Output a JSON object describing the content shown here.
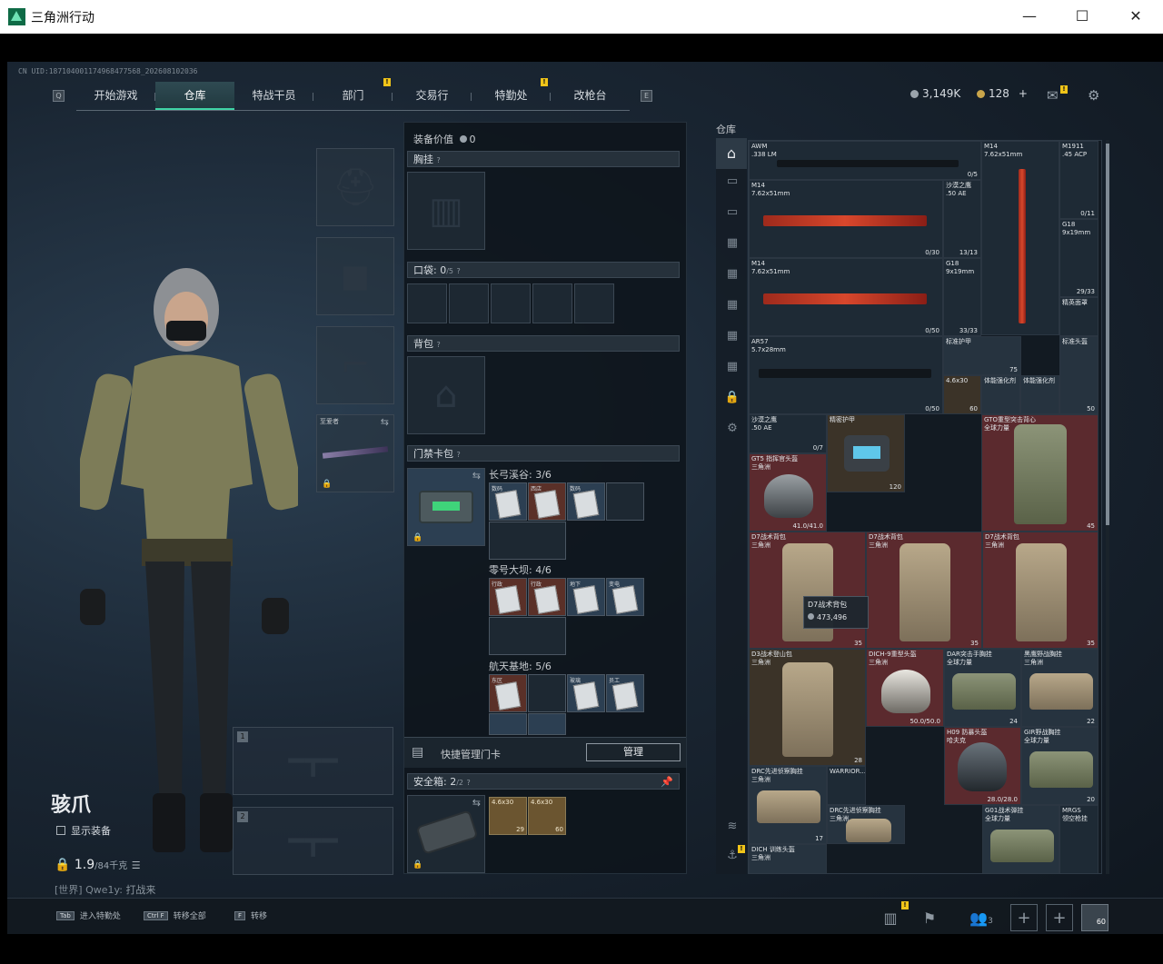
{
  "window": {
    "title": "三角洲行动",
    "min": "—",
    "max": "☐",
    "close": "✕"
  },
  "uid": "CN UID:1871040011749684775​68_202608102036",
  "nav": {
    "key_left": "Q",
    "key_right": "E",
    "tabs": [
      "开始游戏",
      "仓库",
      "特战干员",
      "部门",
      "交易行",
      "特勤处",
      "改枪台"
    ],
    "active": 1,
    "badges": [
      "!",
      "!"
    ]
  },
  "currency": {
    "silver": "3,149K",
    "gold": "128",
    "add": "+"
  },
  "mail_badge": "!",
  "character": {
    "name": "骇爪",
    "show_equipment": "显示装备",
    "weight": "1.9",
    "weight_max": "/84千克",
    "status_tag": "[世界]",
    "status_name": "Qwe1y:",
    "status_text": "打战来",
    "slot_label": "至爱者",
    "slot_nums": [
      "1",
      "2"
    ]
  },
  "center": {
    "equip_value_label": "装备价值",
    "equip_value": "0",
    "chest": "胸挂",
    "pockets": "口袋:",
    "pockets_val": "0",
    "pockets_max": "/5",
    "backpack": "背包",
    "keycard": "门禁卡包",
    "help": "?",
    "card_groups": [
      {
        "label": "长弓溪谷: 3/6",
        "cards": [
          [
            "数码",
            "b"
          ],
          [
            "西店",
            "r"
          ],
          [
            "数码",
            "b"
          ],
          [
            "",
            "e"
          ]
        ]
      },
      {
        "label": "零号大坝: 4/6",
        "cards": [
          [
            "行政",
            "r"
          ],
          [
            "行政",
            "r"
          ],
          [
            "地下",
            "b"
          ],
          [
            "变电",
            "b"
          ]
        ]
      },
      {
        "label": "航天基地: 5/6",
        "cards": [
          [
            "东区",
            "r"
          ],
          [
            "",
            "e"
          ],
          [
            "玻璃",
            "b"
          ],
          [
            "员工",
            "b"
          ]
        ]
      }
    ],
    "quick_manage": "快捷管理门卡",
    "manage_btn": "管理",
    "safebox": "安全箱:",
    "safebox_val": "2",
    "safebox_max": "/2",
    "ammo": [
      {
        "t": "4.6x30",
        "c": "29"
      },
      {
        "t": "4.6x30",
        "c": "60"
      }
    ]
  },
  "warehouse": {
    "title": "仓库",
    "tooltip_name": "D7战术背包",
    "tooltip_val": "473,496",
    "items": [
      {
        "n": "AWM\n.338 LM",
        "c": "0/5"
      },
      {
        "n": "M14\n7.62x51mm",
        "c": ""
      },
      {
        "n": "M1911\n.45 ACP",
        "c": "0/11"
      },
      {
        "n": "M14\n7.62x51mm",
        "c": "0/30"
      },
      {
        "n": "沙漠之鹰\n.50 AE",
        "c": "13/13"
      },
      {
        "n": "G18\n9x19mm",
        "c": "29/33"
      },
      {
        "n": "M14\n7.62x51mm",
        "c": "0/50"
      },
      {
        "n": "G18\n9x19mm",
        "c": "33/33"
      },
      {
        "n": "",
        "c": "0/50"
      },
      {
        "n": "精英面罩",
        "c": ""
      },
      {
        "n": "AR57\n5.7x28mm",
        "c": "0/50"
      },
      {
        "n": "标准护甲",
        "c": "75"
      },
      {
        "n": "标准头盔",
        "c": "50"
      },
      {
        "n": "4.6x30",
        "c": "60"
      },
      {
        "n": "体能强化剂",
        "c": ""
      },
      {
        "n": "体能强化剂",
        "c": ""
      },
      {
        "n": "沙漠之鹰\n.50 AE",
        "c": "0/7"
      },
      {
        "n": "精密护甲",
        "c": "120"
      },
      {
        "n": "GTO重型突击背心\n全球力量",
        "c": "45"
      },
      {
        "n": "GT5 指挥官头盔\n三角洲",
        "c": "41.0/41.0"
      },
      {
        "n": "D7战术背包\n三角洲",
        "c": "35"
      },
      {
        "n": "D7战术背包\n三角洲",
        "c": "35"
      },
      {
        "n": "D7战术背包\n三角洲",
        "c": "35"
      },
      {
        "n": "D3战术登山包\n三角洲",
        "c": "28"
      },
      {
        "n": "DICH-9重型头盔\n三角洲",
        "c": "50.0/50.0"
      },
      {
        "n": "DAR突击手胸挂\n全球力量",
        "c": "24"
      },
      {
        "n": "黑鹰野战胸挂\n三角洲",
        "c": "22"
      },
      {
        "n": "H09 防暴头盔\n哈夫克",
        "c": "28.0/28.0"
      },
      {
        "n": "GIR野战胸挂\n全球力量",
        "c": "20"
      },
      {
        "n": "DRC先进侦察胸挂\n三角洲",
        "c": "17"
      },
      {
        "n": "WARRIOR...",
        "c": ""
      },
      {
        "n": "DRC先进侦察胸挂\n三角洲",
        "c": ""
      },
      {
        "n": "G01战术弹挂\n全球力量",
        "c": ""
      },
      {
        "n": "MRGS\n领空枪挂",
        "c": ""
      },
      {
        "n": "DICH 训练头盔\n三角洲",
        "c": ""
      }
    ]
  },
  "bottom": {
    "hints": [
      {
        "k": "Tab",
        "t": "进入特勤处"
      },
      {
        "k": "Ctrl F",
        "t": "转移全部"
      },
      {
        "k": "F",
        "t": "转移"
      }
    ],
    "squad": "3",
    "level": "60"
  }
}
